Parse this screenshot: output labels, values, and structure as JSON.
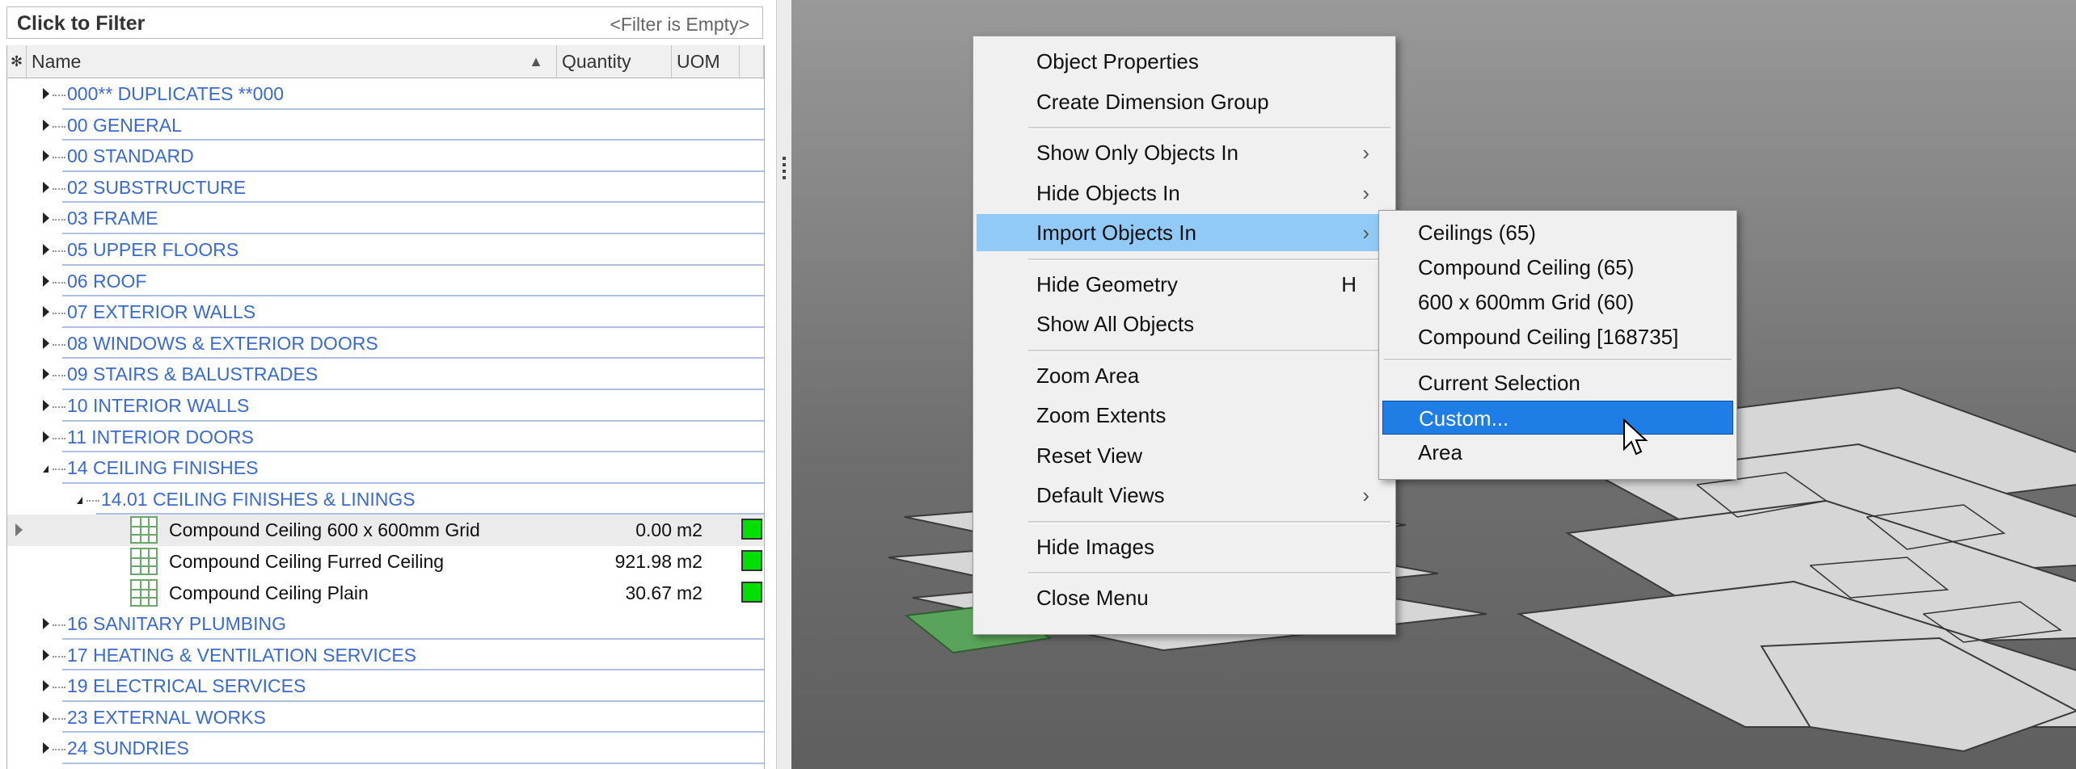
{
  "filter": {
    "label": "Click to Filter",
    "status": "<Filter is Empty>"
  },
  "columns": {
    "name": "Name",
    "quantity": "Quantity",
    "uom": "UOM"
  },
  "tree": [
    {
      "label": "000** DUPLICATES **000",
      "level": 0,
      "expanded": false
    },
    {
      "label": "00 GENERAL",
      "level": 0,
      "expanded": false
    },
    {
      "label": "00 STANDARD",
      "level": 0,
      "expanded": false
    },
    {
      "label": "02 SUBSTRUCTURE",
      "level": 0,
      "expanded": false
    },
    {
      "label": "03 FRAME",
      "level": 0,
      "expanded": false
    },
    {
      "label": "05 UPPER FLOORS",
      "level": 0,
      "expanded": false
    },
    {
      "label": "06 ROOF",
      "level": 0,
      "expanded": false
    },
    {
      "label": "07 EXTERIOR WALLS",
      "level": 0,
      "expanded": false
    },
    {
      "label": "08 WINDOWS & EXTERIOR DOORS",
      "level": 0,
      "expanded": false
    },
    {
      "label": "09 STAIRS & BALUSTRADES",
      "level": 0,
      "expanded": false
    },
    {
      "label": "10 INTERIOR WALLS",
      "level": 0,
      "expanded": false
    },
    {
      "label": "11 INTERIOR DOORS",
      "level": 0,
      "expanded": false
    },
    {
      "label": "14 CEILING FINISHES",
      "level": 0,
      "expanded": true
    },
    {
      "label": "14.01 CEILING FINISHES & LININGS",
      "level": 1,
      "expanded": true
    },
    {
      "label": "Compound Ceiling 600 x 600mm Grid",
      "level": 2,
      "item": true,
      "qty": "0.00",
      "uom": "m2",
      "selected": true
    },
    {
      "label": "Compound Ceiling Furred Ceiling",
      "level": 2,
      "item": true,
      "qty": "921.98",
      "uom": "m2"
    },
    {
      "label": "Compound Ceiling Plain",
      "level": 2,
      "item": true,
      "qty": "30.67",
      "uom": "m2"
    },
    {
      "label": "16 SANITARY PLUMBING",
      "level": 0,
      "expanded": false
    },
    {
      "label": "17 HEATING & VENTILATION SERVICES",
      "level": 0,
      "expanded": false
    },
    {
      "label": "19 ELECTRICAL SERVICES",
      "level": 0,
      "expanded": false
    },
    {
      "label": "23 EXTERNAL WORKS",
      "level": 0,
      "expanded": false
    },
    {
      "label": "24 SUNDRIES",
      "level": 0,
      "expanded": false
    }
  ],
  "context_menu": [
    {
      "label": "Object Properties"
    },
    {
      "label": "Create Dimension Group"
    },
    {
      "sep": true
    },
    {
      "label": "Show Only Objects In",
      "submenu": true
    },
    {
      "label": "Hide Objects In",
      "submenu": true
    },
    {
      "label": "Import Objects In",
      "submenu": true,
      "highlight": true
    },
    {
      "sep": true
    },
    {
      "label": "Hide Geometry",
      "shortcut": "H"
    },
    {
      "label": "Show All Objects"
    },
    {
      "sep": true
    },
    {
      "label": "Zoom Area"
    },
    {
      "label": "Zoom Extents"
    },
    {
      "label": "Reset View"
    },
    {
      "label": "Default Views",
      "submenu": true
    },
    {
      "sep": true
    },
    {
      "label": "Hide Images"
    },
    {
      "sep": true
    },
    {
      "label": "Close Menu"
    }
  ],
  "submenu": [
    {
      "label": "Ceilings (65)"
    },
    {
      "label": "Compound Ceiling (65)"
    },
    {
      "label": "600 x 600mm Grid (60)"
    },
    {
      "label": "Compound Ceiling [168735]"
    },
    {
      "sep": true
    },
    {
      "label": "Current Selection"
    },
    {
      "label": "Custom...",
      "highlight": true
    },
    {
      "label": "Area"
    }
  ],
  "icons": {
    "sort": "sort-ascending-icon",
    "submenu_arrow": "chevron-right-icon",
    "cursor": "mouse-pointer-icon"
  },
  "colors": {
    "menu_highlight": "#91c9f7",
    "submenu_highlight": "#1e7ee6",
    "category_text": "#3a6ad0",
    "swatch": "#00e000"
  },
  "glyphs": {
    "asterisk": "✻",
    "sort": "▲",
    "submenu_arrow": "›"
  }
}
